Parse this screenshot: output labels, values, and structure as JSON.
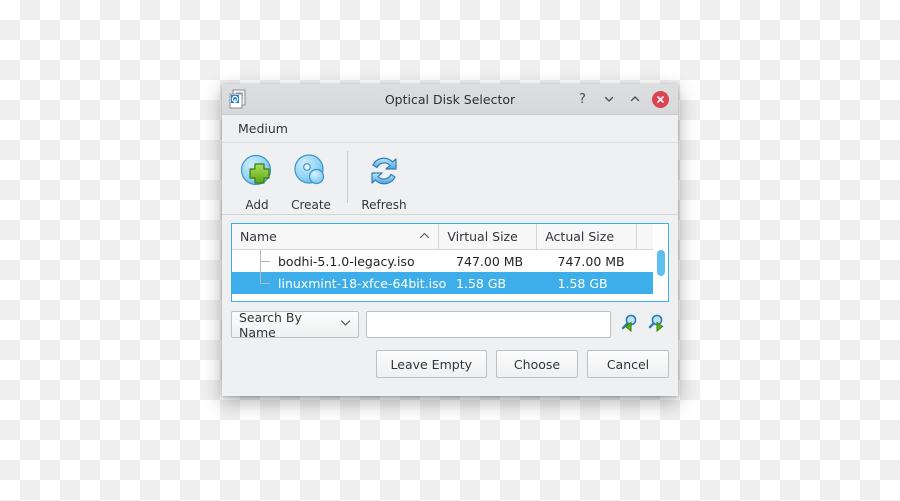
{
  "window": {
    "title": "Optical Disk Selector",
    "icon": "optical-disk-document-icon",
    "controls": {
      "help": "?",
      "minimize": "⌄",
      "maximize": "⌃",
      "close": "×"
    }
  },
  "menubar": {
    "items": [
      {
        "label": "Medium"
      }
    ]
  },
  "toolbar": {
    "buttons": [
      {
        "label": "Add",
        "icon": "add-disk-icon"
      },
      {
        "label": "Create",
        "icon": "create-disk-icon"
      },
      {
        "label": "Refresh",
        "icon": "refresh-icon"
      }
    ]
  },
  "table": {
    "columns": [
      {
        "label": "Name",
        "sort": "ascending"
      },
      {
        "label": "Virtual Size",
        "sort": "none"
      },
      {
        "label": "Actual Size",
        "sort": "none"
      }
    ],
    "rows": [
      {
        "name": "bodhi-5.1.0-legacy.iso",
        "virtual_size": "747.00 MB",
        "actual_size": "747.00 MB",
        "selected": false
      },
      {
        "name": "linuxmint-18-xfce-64bit.iso",
        "virtual_size": "1.58 GB",
        "actual_size": "1.58 GB",
        "selected": true
      }
    ]
  },
  "search": {
    "mode_label": "Search By Name",
    "mode_options": [
      "Search By Name"
    ],
    "value": "",
    "placeholder": "",
    "prev_icon": "search-previous-icon",
    "next_icon": "search-next-icon"
  },
  "footer": {
    "buttons": [
      {
        "label": "Leave Empty"
      },
      {
        "label": "Choose"
      },
      {
        "label": "Cancel"
      }
    ]
  },
  "colors": {
    "selection": "#3daee9",
    "close_button": "#da4453",
    "window_background": "#eff0f1",
    "table_background": "#ffffff"
  }
}
